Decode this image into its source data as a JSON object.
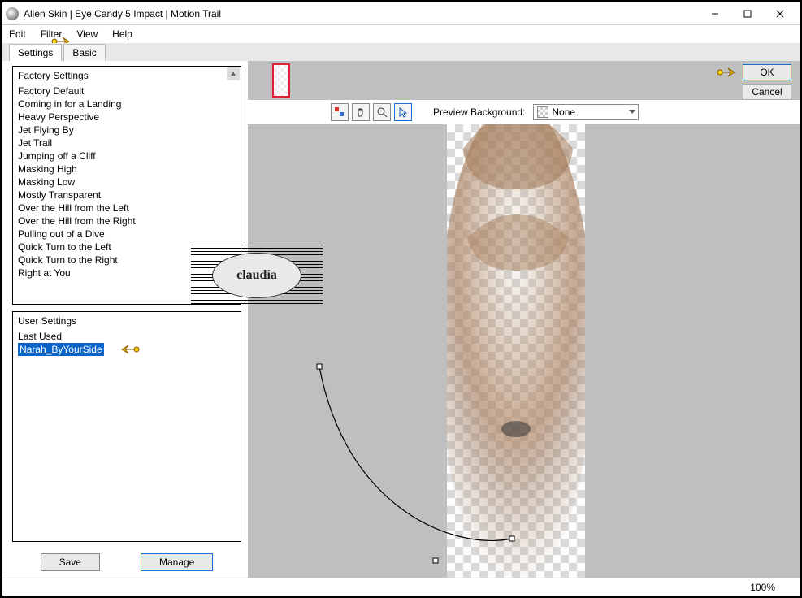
{
  "window": {
    "title": "Alien Skin | Eye Candy 5 Impact | Motion Trail"
  },
  "menu": {
    "edit": "Edit",
    "filter": "Filter",
    "view": "View",
    "help": "Help"
  },
  "tabs": {
    "settings": "Settings",
    "basic": "Basic"
  },
  "factory": {
    "header": "Factory Settings",
    "items": [
      "Factory Default",
      "Coming in for a Landing",
      "Heavy Perspective",
      "Jet Flying By",
      "Jet Trail",
      "Jumping off a Cliff",
      "Masking High",
      "Masking Low",
      "Mostly Transparent",
      "Over the Hill from the Left",
      "Over the Hill from the Right",
      "Pulling out of a Dive",
      "Quick Turn to the Left",
      "Quick Turn to the Right",
      "Right at You"
    ]
  },
  "user": {
    "header": "User Settings",
    "items": [
      "Last Used",
      "Narah_ByYourSide"
    ],
    "selected_index": 1
  },
  "buttons": {
    "save": "Save",
    "manage": "Manage",
    "ok": "OK",
    "cancel": "Cancel"
  },
  "toolbar": {
    "preview_bg_label": "Preview Background:",
    "preview_bg_value": "None"
  },
  "status": {
    "zoom": "100%"
  },
  "stamp": {
    "text": "claudia"
  }
}
